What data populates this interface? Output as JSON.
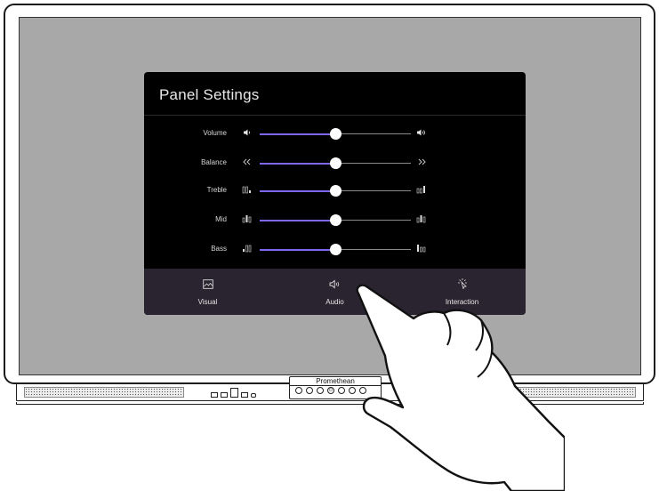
{
  "panel": {
    "title": "Panel Settings",
    "sliders": [
      {
        "label": "Volume",
        "left_icon": "volume-low-icon",
        "right_icon": "volume-high-icon",
        "value": 0.5
      },
      {
        "label": "Balance",
        "left_icon": "chevron-left-double-icon",
        "right_icon": "chevron-right-double-icon",
        "value": 0.5
      },
      {
        "label": "Treble",
        "left_icon": "treble-low-icon",
        "right_icon": "treble-high-icon",
        "value": 0.5
      },
      {
        "label": "Mid",
        "left_icon": "mid-low-icon",
        "right_icon": "mid-high-icon",
        "value": 0.5
      },
      {
        "label": "Bass",
        "left_icon": "bass-low-icon",
        "right_icon": "bass-high-icon",
        "value": 0.5
      }
    ],
    "tabs": [
      {
        "label": "Visual",
        "icon": "picture-icon"
      },
      {
        "label": "Audio",
        "icon": "speaker-icon",
        "active": true
      },
      {
        "label": "Interaction",
        "icon": "touch-icon"
      }
    ]
  },
  "device": {
    "brand": "Promethean"
  },
  "colors": {
    "accent": "#7b68ee",
    "panel_bg": "#000000",
    "tabbar_bg": "#2a2430",
    "screen_bg": "#a8a8a8"
  }
}
